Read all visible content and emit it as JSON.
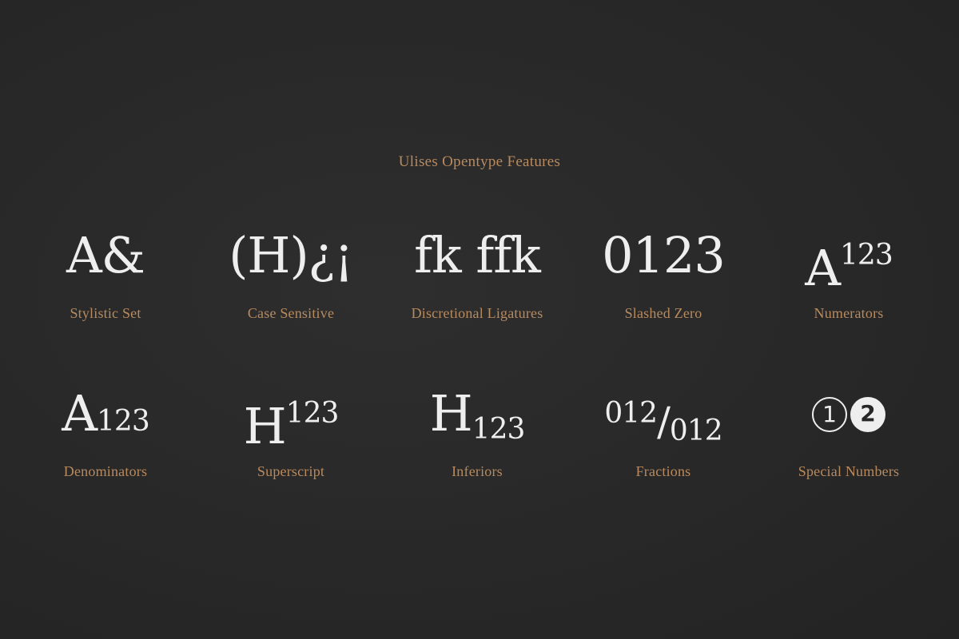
{
  "title": "Ulises Opentype Features",
  "features": [
    {
      "sample": "A&",
      "label": "Stylistic Set"
    },
    {
      "sample": "(H)¿¡",
      "label": "Case Sensitive"
    },
    {
      "sample": "fk ffk",
      "label": "Discretional Ligatures"
    },
    {
      "sample": "0123",
      "label": "Slashed Zero"
    },
    {
      "base": "A",
      "figures": "123",
      "label": "Numerators"
    },
    {
      "base": "A",
      "figures": "123",
      "label": "Denominators"
    },
    {
      "base": "H",
      "figures": "123",
      "label": "Superscript"
    },
    {
      "base": "H",
      "figures": "123",
      "label": "Inferiors"
    },
    {
      "numerator": "012",
      "slash": "/",
      "denominator": "012",
      "label": "Fractions"
    },
    {
      "outlined": "1",
      "filled": "2",
      "label": "Special Numbers"
    }
  ],
  "colors": {
    "background": "#282828",
    "sample_text": "#eeeeee",
    "label_text": "#b88a5e"
  }
}
